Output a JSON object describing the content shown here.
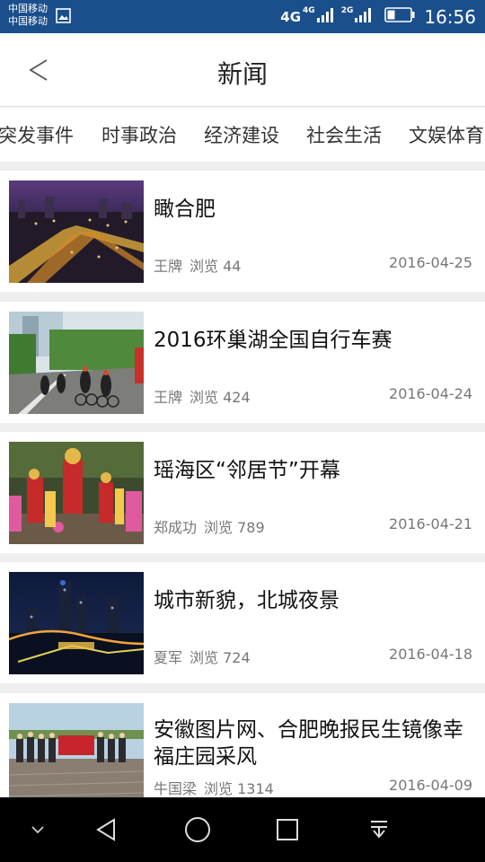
{
  "status_bar": {
    "carrier1": "中国移动",
    "carrier2": "中国移动",
    "net_main": "4G",
    "net_sub1": "4G",
    "net_sub2": "2G",
    "time": "16:56"
  },
  "header": {
    "title": "新闻"
  },
  "tabs": [
    {
      "label": "突发事件"
    },
    {
      "label": "时事政治"
    },
    {
      "label": "经济建设"
    },
    {
      "label": "社会生活"
    },
    {
      "label": "文娱体育"
    }
  ],
  "news": [
    {
      "title": "瞰合肥",
      "author": "王牌",
      "views": "浏览 44",
      "date": "2016-04-25"
    },
    {
      "title": "2016环巢湖全国自行车赛",
      "author": "王牌",
      "views": "浏览 424",
      "date": "2016-04-24"
    },
    {
      "title": "瑶海区“邻居节”开幕",
      "author": "郑成功",
      "views": "浏览 789",
      "date": "2016-04-21"
    },
    {
      "title": "城市新貌，北城夜景",
      "author": "夏军",
      "views": "浏览 724",
      "date": "2016-04-18"
    },
    {
      "title": " 安徽图片网、合肥晚报民生镜像幸福庄园采风",
      "author": "牛国梁",
      "views": "浏览 1314",
      "date": "2016-04-09"
    }
  ],
  "icons": {
    "back": "back-arrow-icon",
    "gallery": "image-icon",
    "nav": [
      "chevron-down-icon",
      "back-triangle-icon",
      "home-circle-icon",
      "recents-square-icon",
      "notification-pull-icon"
    ]
  },
  "colors": {
    "status_bar": "#1a4f8c",
    "background": "#efefef",
    "nav_bar": "#000000"
  }
}
